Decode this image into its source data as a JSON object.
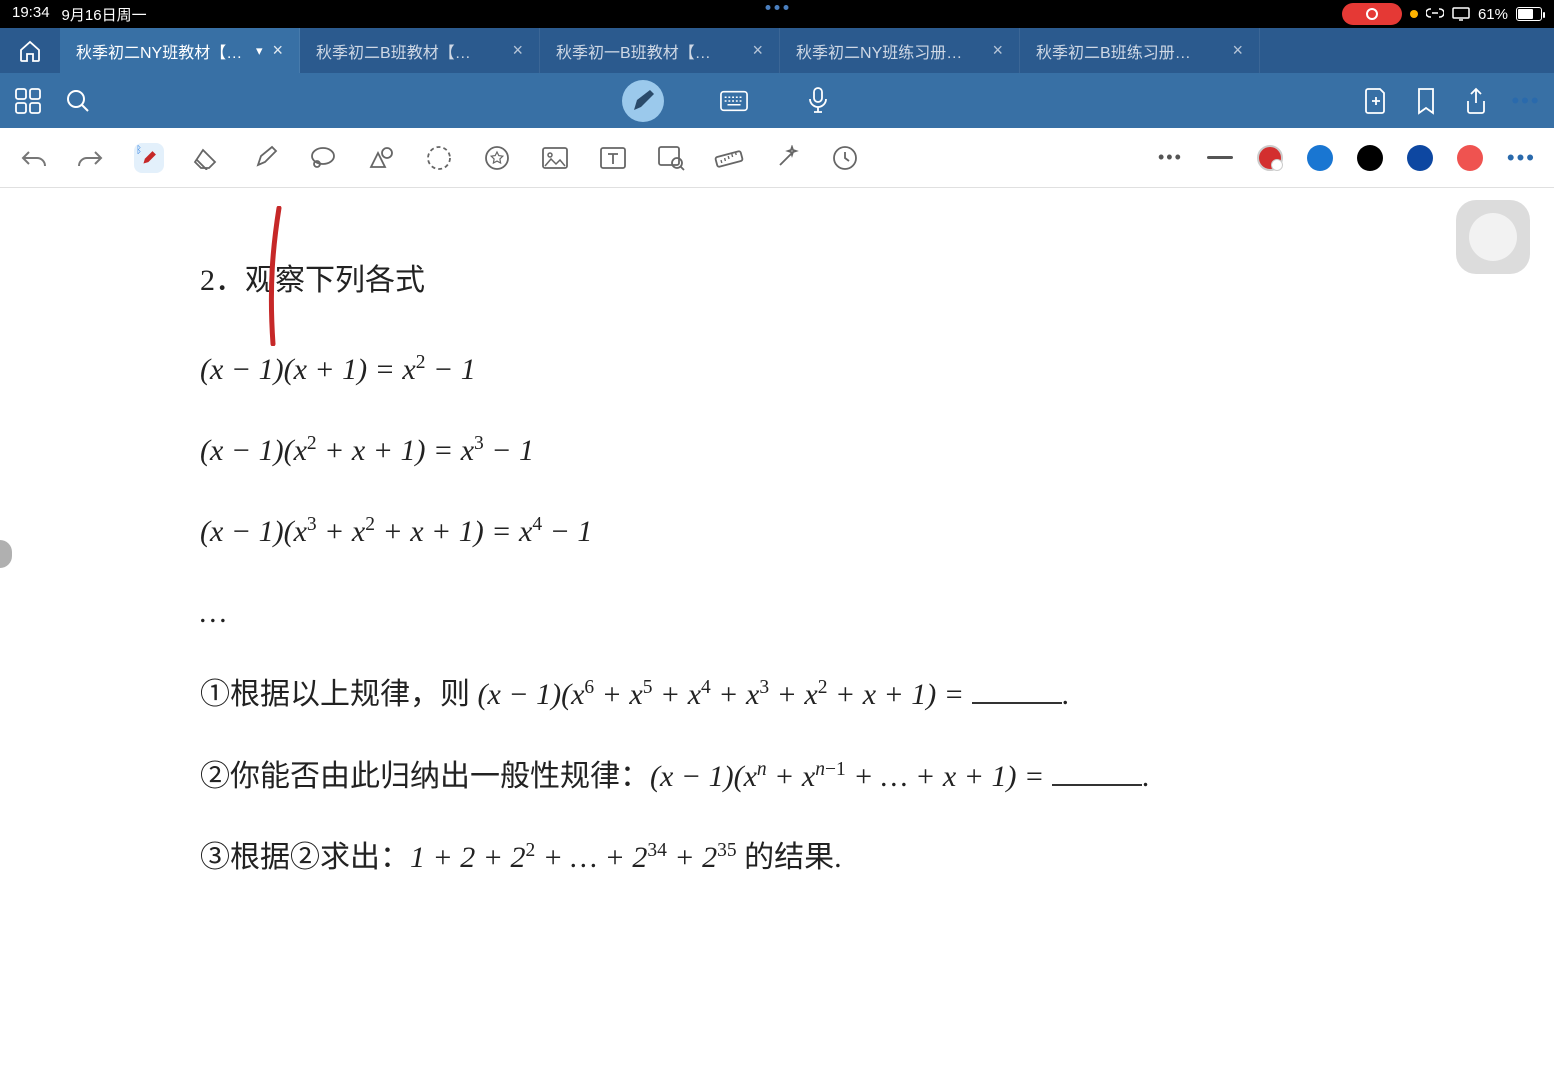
{
  "status": {
    "time": "19:34",
    "date": "9月16日周一",
    "battery_percent": "61%",
    "indicators": {
      "link": true,
      "dnd": true,
      "screen": true
    }
  },
  "tabs": {
    "home_aria": "home",
    "items": [
      {
        "label": "秋季初二NY班教材【含...",
        "active": true,
        "has_chevron": true
      },
      {
        "label": "秋季初二B班教材【含封面】",
        "active": false
      },
      {
        "label": "秋季初一B班教材【含封面】",
        "active": false
      },
      {
        "label": "秋季初二NY班练习册【含...",
        "active": false
      },
      {
        "label": "秋季初二B班练习册【含封...",
        "active": false
      }
    ]
  },
  "appbar": {
    "grid_label": "grid",
    "search_label": "search",
    "pen_label": "pen",
    "keyboard_label": "keyboard",
    "mic_label": "microphone",
    "new_label": "new",
    "bookmark_label": "bookmark",
    "share_label": "share",
    "more_label": "more"
  },
  "toolbar": {
    "undo": "undo",
    "redo": "redo",
    "pen": "pen-tool",
    "eraser": "eraser",
    "highlighter": "highlighter",
    "lasso": "lasso",
    "shapes": "shapes",
    "dashed_lasso": "dashed-lasso",
    "star_circle": "stamp",
    "image": "image",
    "text_box": "text-box",
    "image_search": "image-search",
    "ruler": "ruler",
    "wand": "wand",
    "clock": "clock",
    "colors": {
      "c1": "#d32f2f",
      "c2": "#1976d2",
      "c3": "#000000",
      "c4": "#0d47a1",
      "c5": "#ef5350",
      "active_index": 0
    }
  },
  "document": {
    "heading": "2．观察下列各式",
    "eq1_html": "(<i>x</i> − 1)(<i>x</i> + 1) = <i>x</i><span class='sup'>2</span> − 1",
    "eq2_html": "(<i>x</i> − 1)(<i>x</i><span class='sup'>2</span> + <i>x</i> + 1) = <i>x</i><span class='sup'>3</span> − 1",
    "eq3_html": "(<i>x</i> − 1)(<i>x</i><span class='sup'>3</span> + <i>x</i><span class='sup'>2</span> + <i>x</i> + 1) = <i>x</i><span class='sup'>4</span> − 1",
    "ellipsis": "…",
    "q1_html": "<span class='cn'>①根据以上规律，则 </span>(<i>x</i> − 1)(<i>x</i><span class='sup'>6</span> + <i>x</i><span class='sup'>5</span> + <i>x</i><span class='sup'>4</span> + <i>x</i><span class='sup'>3</span> + <i>x</i><span class='sup'>2</span> + <i>x</i> + 1) = <span class='blank'></span><span class='cn'>.</span>",
    "q2_html": "<span class='cn'>②你能否由此归纳出一般性规律：</span>(<i>x</i> − 1)(<i>x</i><span class='sup'><i>n</i></span> + <i>x</i><span class='sup'><i>n</i>−1</span> + … + <i>x</i> + 1) = <span class='blank'></span><span class='cn'>.</span>",
    "q3_html": "<span class='cn'>③根据②求出：</span>1 + 2 + 2<span class='sup'>2</span> + … + 2<span class='sup'>34</span> + 2<span class='sup'>35</span> <span class='cn'>的结果.</span>"
  }
}
